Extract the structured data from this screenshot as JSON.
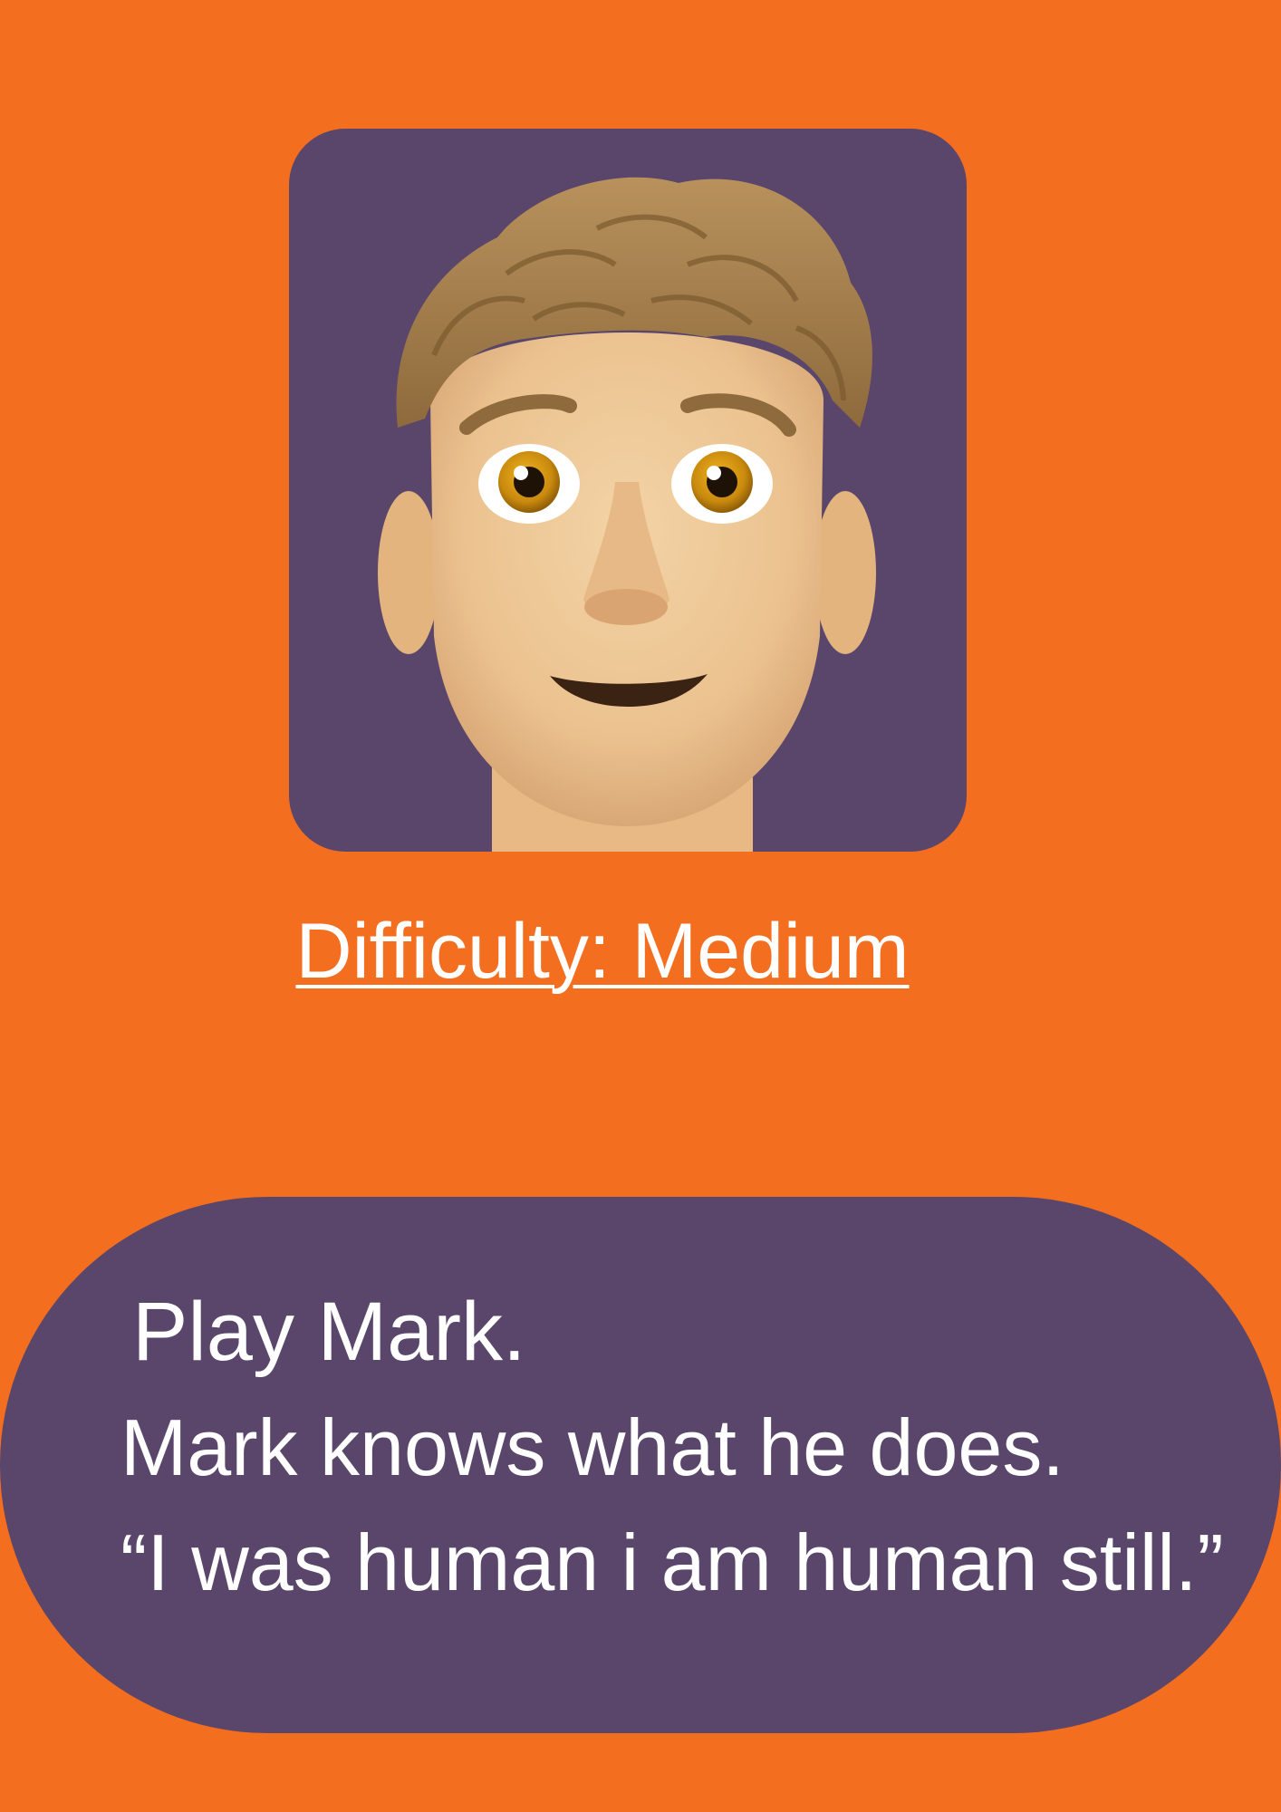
{
  "colors": {
    "background": "#F46E1F",
    "card": "#5A466A",
    "text": "#FFFFFF"
  },
  "avatar": {
    "icon": "memoji-man-curly-hair-icon"
  },
  "difficulty_label": "Difficulty: Medium",
  "intro": {
    "title": "Play Mark.",
    "description": "Mark knows what he does.",
    "quote": "“I was human i am human still.”"
  }
}
